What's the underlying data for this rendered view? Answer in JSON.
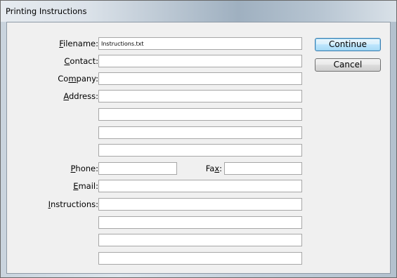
{
  "window": {
    "title": "Printing Instructions"
  },
  "labels": {
    "filename": [
      "",
      "F",
      "ilename:"
    ],
    "contact": [
      "",
      "C",
      "ontact:"
    ],
    "company": [
      "Co",
      "m",
      "pany:"
    ],
    "address": [
      "",
      "A",
      "ddress:"
    ],
    "phone": [
      "",
      "P",
      "hone:"
    ],
    "fax": [
      "Fa",
      "x",
      ":"
    ],
    "email": [
      "",
      "E",
      "mail:"
    ],
    "instructions": [
      "",
      "I",
      "nstructions:"
    ]
  },
  "fields": {
    "filename": "Instructions.txt",
    "contact": "",
    "company": "",
    "address": [
      "",
      "",
      "",
      ""
    ],
    "phone": "",
    "fax": "",
    "email": "",
    "instructions": [
      "",
      "",
      "",
      ""
    ]
  },
  "buttons": {
    "continue": "Continue",
    "cancel": "Cancel"
  }
}
